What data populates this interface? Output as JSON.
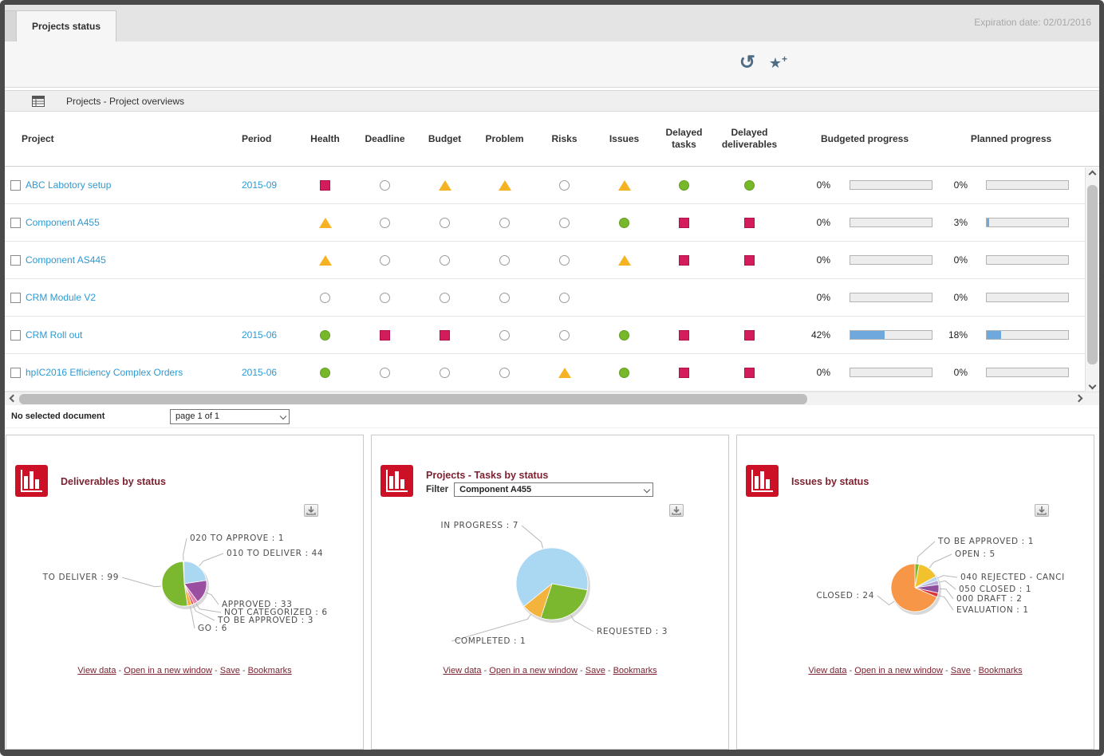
{
  "window": {
    "tab_label": "Projects status",
    "expiration_label": "Expiration date: 02/01/2016"
  },
  "toolbar": {
    "icons": [
      "undo",
      "bookmark-add"
    ]
  },
  "report": {
    "title": "Projects - Project overviews"
  },
  "table": {
    "columns": [
      "Project",
      "Period",
      "Health",
      "Deadline",
      "Budget",
      "Problem",
      "Risks",
      "Issues",
      "Delayed tasks",
      "Delayed deliverables",
      "Budgeted progress",
      "Planned progress"
    ],
    "rows": [
      {
        "project": "ABC Labotory setup",
        "period": "2015-09",
        "health": "red-square",
        "deadline": "circle",
        "budget": "triangle",
        "problem": "triangle",
        "risks": "circle",
        "issues": "triangle",
        "delayed_tasks": "green-circle",
        "delayed_deliverables": "green-circle",
        "budgeted_pct": "0%",
        "budgeted_value": 0,
        "planned_pct": "0%",
        "planned_value": 0
      },
      {
        "project": "Component A455",
        "period": "",
        "health": "triangle",
        "deadline": "circle",
        "budget": "circle",
        "problem": "circle",
        "risks": "circle",
        "issues": "green-circle",
        "delayed_tasks": "red-square",
        "delayed_deliverables": "red-square",
        "budgeted_pct": "0%",
        "budgeted_value": 0,
        "planned_pct": "3%",
        "planned_value": 3
      },
      {
        "project": "Component AS445",
        "period": "",
        "health": "triangle",
        "deadline": "circle",
        "budget": "circle",
        "problem": "circle",
        "risks": "circle",
        "issues": "triangle",
        "delayed_tasks": "red-square",
        "delayed_deliverables": "red-square",
        "budgeted_pct": "0%",
        "budgeted_value": 0,
        "planned_pct": "0%",
        "planned_value": 0
      },
      {
        "project": "CRM Module V2",
        "period": "",
        "health": "circle",
        "deadline": "circle",
        "budget": "circle",
        "problem": "circle",
        "risks": "circle",
        "issues": "",
        "delayed_tasks": "",
        "delayed_deliverables": "",
        "budgeted_pct": "0%",
        "budgeted_value": 0,
        "planned_pct": "0%",
        "planned_value": 0
      },
      {
        "project": "CRM Roll out",
        "period": "2015-06",
        "health": "green-circle",
        "deadline": "red-square",
        "budget": "red-square",
        "problem": "circle",
        "risks": "circle",
        "issues": "green-circle",
        "delayed_tasks": "red-square",
        "delayed_deliverables": "red-square",
        "budgeted_pct": "42%",
        "budgeted_value": 42,
        "planned_pct": "18%",
        "planned_value": 18
      },
      {
        "project": "hpIC2016 Efficiency Complex Orders",
        "period": "2015-06",
        "health": "green-circle",
        "deadline": "circle",
        "budget": "circle",
        "problem": "circle",
        "risks": "triangle",
        "issues": "green-circle",
        "delayed_tasks": "red-square",
        "delayed_deliverables": "red-square",
        "budgeted_pct": "0%",
        "budgeted_value": 0,
        "planned_pct": "0%",
        "planned_value": 0
      }
    ]
  },
  "footer": {
    "status": "No selected document",
    "page_select": "page 1 of 1"
  },
  "panel_links": [
    "View data",
    "Open in a new window",
    "Save",
    "Bookmarks"
  ],
  "colors": {
    "status_red": "#d31c5c",
    "status_green": "#76b82a",
    "status_amber": "#f5b324",
    "progress_fill": "#6fa8dc",
    "link_blue": "#2d9ad3",
    "panel_title": "#7c2230",
    "panel_icon_red": "#cc1126"
  },
  "chart_data": [
    {
      "type": "pie",
      "title": "Deliverables by status",
      "labels": [
        "020 TO APPROVE : 1",
        "010 TO DELIVER : 44",
        "APPROVED : 33",
        "NOT CATEGORIZED : 6",
        "TO BE APPROVED : 3",
        "GO : 6",
        "TO DELIVER : 99"
      ],
      "values": [
        1,
        44,
        33,
        6,
        3,
        6,
        99
      ],
      "colors": [
        "#f7c6d9",
        "#aad7f2",
        "#9a4fa0",
        "#e87fb2",
        "#e03a3a",
        "#f3b33c",
        "#7cb82f"
      ],
      "start_angle": -3,
      "legend_position": "callout-labels"
    },
    {
      "type": "pie",
      "title": "Projects - Tasks by status",
      "filter": {
        "label": "Filter",
        "value": "Component A455"
      },
      "labels": [
        "IN PROGRESS : 7",
        "REQUESTED : 3",
        "COMPLETED : 1"
      ],
      "values": [
        7,
        3,
        1
      ],
      "colors": [
        "#aad7f2",
        "#7cb82f",
        "#f3b33c"
      ],
      "start_angle": -129,
      "legend_position": "callout-labels"
    },
    {
      "type": "pie",
      "title": "Issues by status",
      "labels": [
        "TO BE APPROVED : 1",
        "OPEN : 5",
        "040 REJECTED - CANCI",
        "050 CLOSED : 1",
        "000 DRAFT : 2",
        "EVALUATION : 1",
        "CLOSED : 24"
      ],
      "values": [
        1,
        5,
        1,
        1,
        2,
        1,
        24
      ],
      "colors": [
        "#7cb82f",
        "#f2c12e",
        "#b9d7f0",
        "#b3a7d6",
        "#8f4f9f",
        "#d9363a",
        "#f79646"
      ],
      "start_angle": 0,
      "legend_position": "callout-labels"
    }
  ]
}
